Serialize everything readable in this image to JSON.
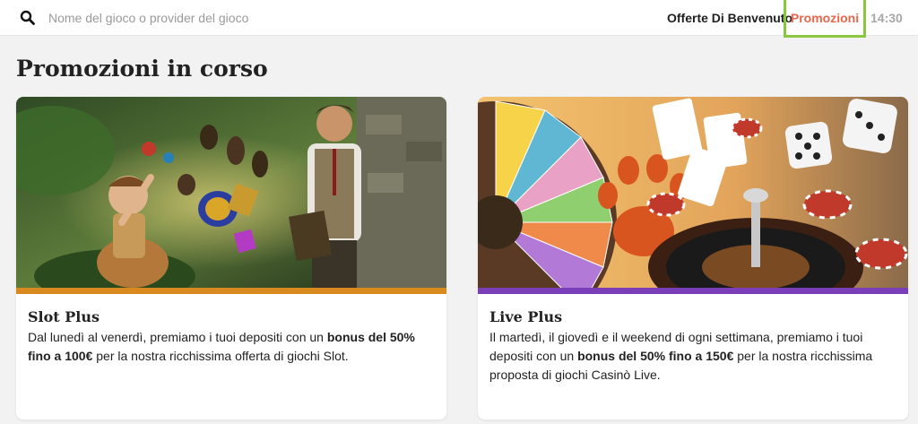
{
  "search": {
    "placeholder": "Nome del gioco o provider del gioco",
    "icon": "search-icon"
  },
  "nav": {
    "welcome_label": "Offerte Di Benvenuto",
    "promo_label": "Promozioni",
    "clock": "14:30"
  },
  "colors": {
    "accent": "#e8674a",
    "highlight": "#8cc63f",
    "slot_bar": "#d98a1f",
    "live_bar": "#7a3fb8"
  },
  "page": {
    "title": "Promozioni in corso"
  },
  "cards": [
    {
      "title": "Slot Plus",
      "text_a": "Dal lunedì al venerdì, premiamo i tuoi depositi con un ",
      "text_bold": "bonus del 50% fino a 100€",
      "text_b": " per la nostra ricchissima offerta di giochi Slot."
    },
    {
      "title": "Live Plus",
      "text_a": "Il martedì, il giovedì e il weekend di ogni settimana, premiamo i tuoi depositi con un ",
      "text_bold": "bonus del 50% fino a 150€",
      "text_b": " per la nostra ricchissima proposta di giochi Casinò Live."
    }
  ]
}
